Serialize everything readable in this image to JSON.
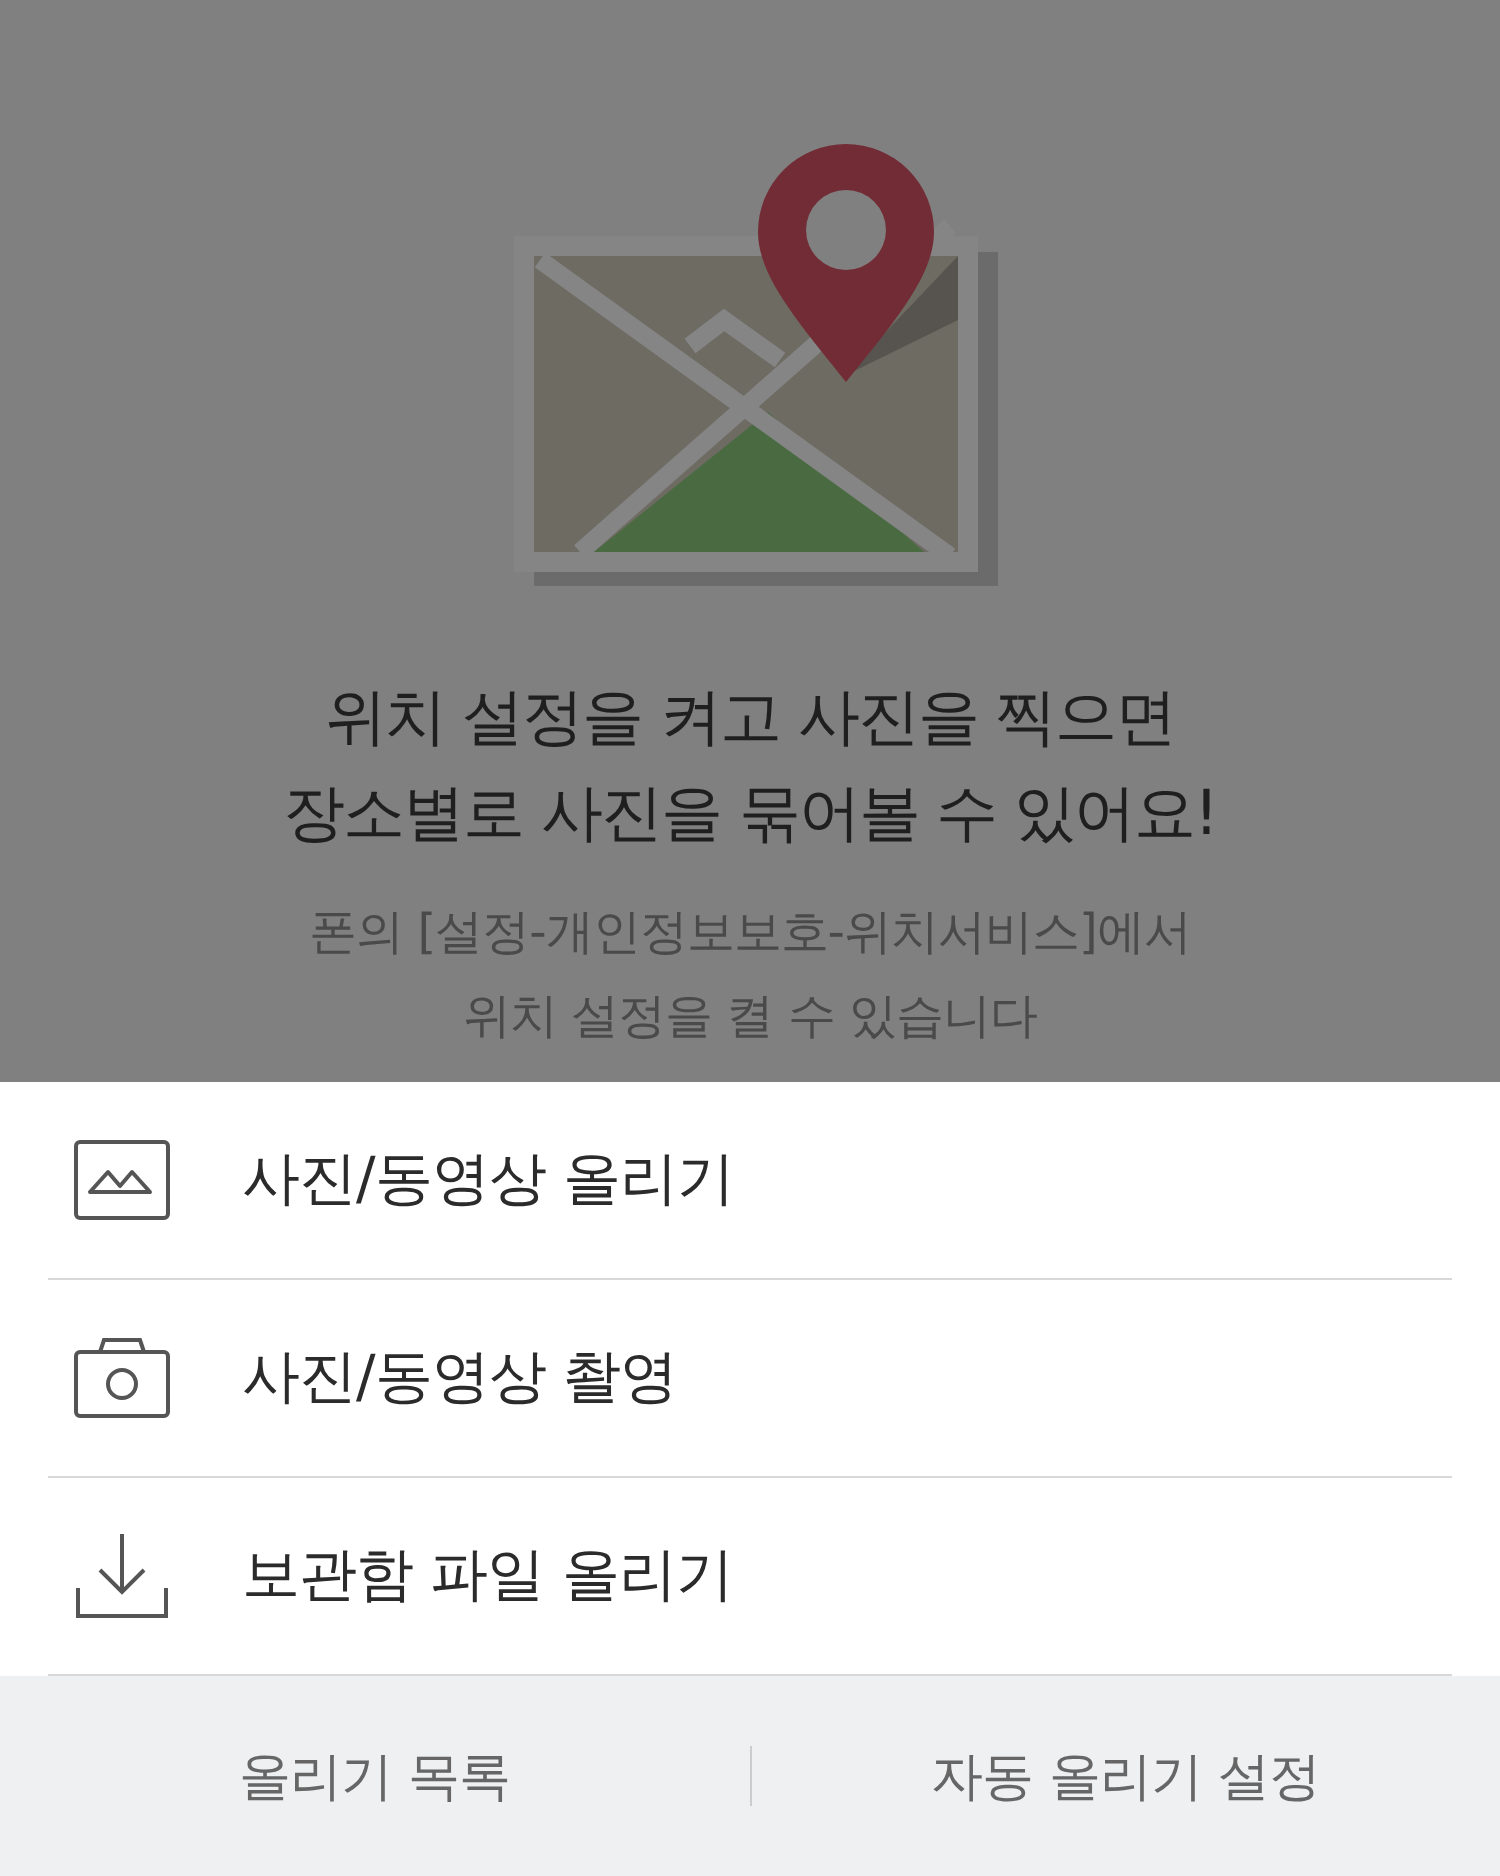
{
  "illustration": {
    "kind": "picture"
  },
  "title_lines": [
    "위치 설정을 켜고 사진을 찍으면",
    "장소별로 사진을 묶어볼 수 있어요!"
  ],
  "description_lines": [
    "폰의 [설정-개인정보보호-위치서비스]에서",
    "위치 설정을 켤 수 있습니다"
  ],
  "menu": [
    {
      "kind": "gallery",
      "label": "사진/동영상 올리기"
    },
    {
      "kind": "camera",
      "label": "사진/동영상 촬영"
    },
    {
      "kind": "download",
      "label": "보관함 파일 올리기"
    }
  ],
  "footer_buttons": [
    "올리기 목록",
    "자동 올리기 설정"
  ]
}
